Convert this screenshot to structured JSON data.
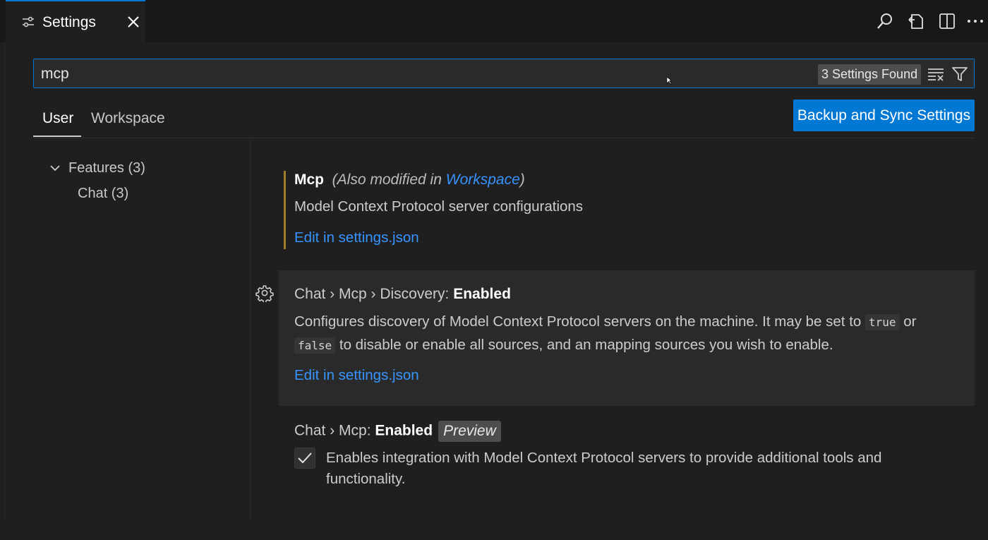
{
  "tab": {
    "label": "Settings"
  },
  "search": {
    "value": "mcp",
    "results_count": "3 Settings Found"
  },
  "scopes": {
    "user": "User",
    "workspace": "Workspace"
  },
  "sync_button": "Backup and Sync Settings",
  "toc": [
    {
      "label": "Features (3)",
      "expanded": true
    },
    {
      "label": "Chat (3)"
    }
  ],
  "settings": [
    {
      "title": "Mcp",
      "modified_prefix": "(Also modified in ",
      "modified_link": "Workspace",
      "modified_suffix": ")",
      "description": "Model Context Protocol server configurations",
      "link": "Edit in settings.json"
    },
    {
      "category": "Chat › Mcp › Discovery: ",
      "title": "Enabled",
      "desc_part1": "Configures discovery of Model Context Protocol servers on the machine. It may be set to ",
      "code_true": "true",
      "desc_part2": " or ",
      "code_false": "false",
      "desc_part3": " to disable or enable all sources, and an mapping sources you wish to enable.",
      "link": "Edit in settings.json"
    },
    {
      "category": "Chat › Mcp: ",
      "title": "Enabled",
      "badge": "Preview",
      "checked": true,
      "description": "Enables integration with Model Context Protocol servers to provide additional tools and functionality."
    }
  ],
  "colors": {
    "accent": "#0078d4",
    "link": "#3794ff",
    "modified_indicator": "#a07d2b",
    "background": "#1f1f1f"
  }
}
